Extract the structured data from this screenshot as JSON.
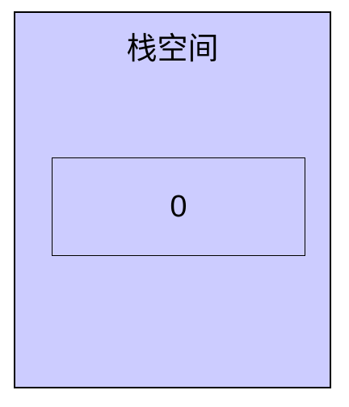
{
  "stack": {
    "title": "栈空间",
    "background_color": "#ccccff",
    "border_color": "#000000",
    "cell": {
      "value": "0"
    }
  }
}
